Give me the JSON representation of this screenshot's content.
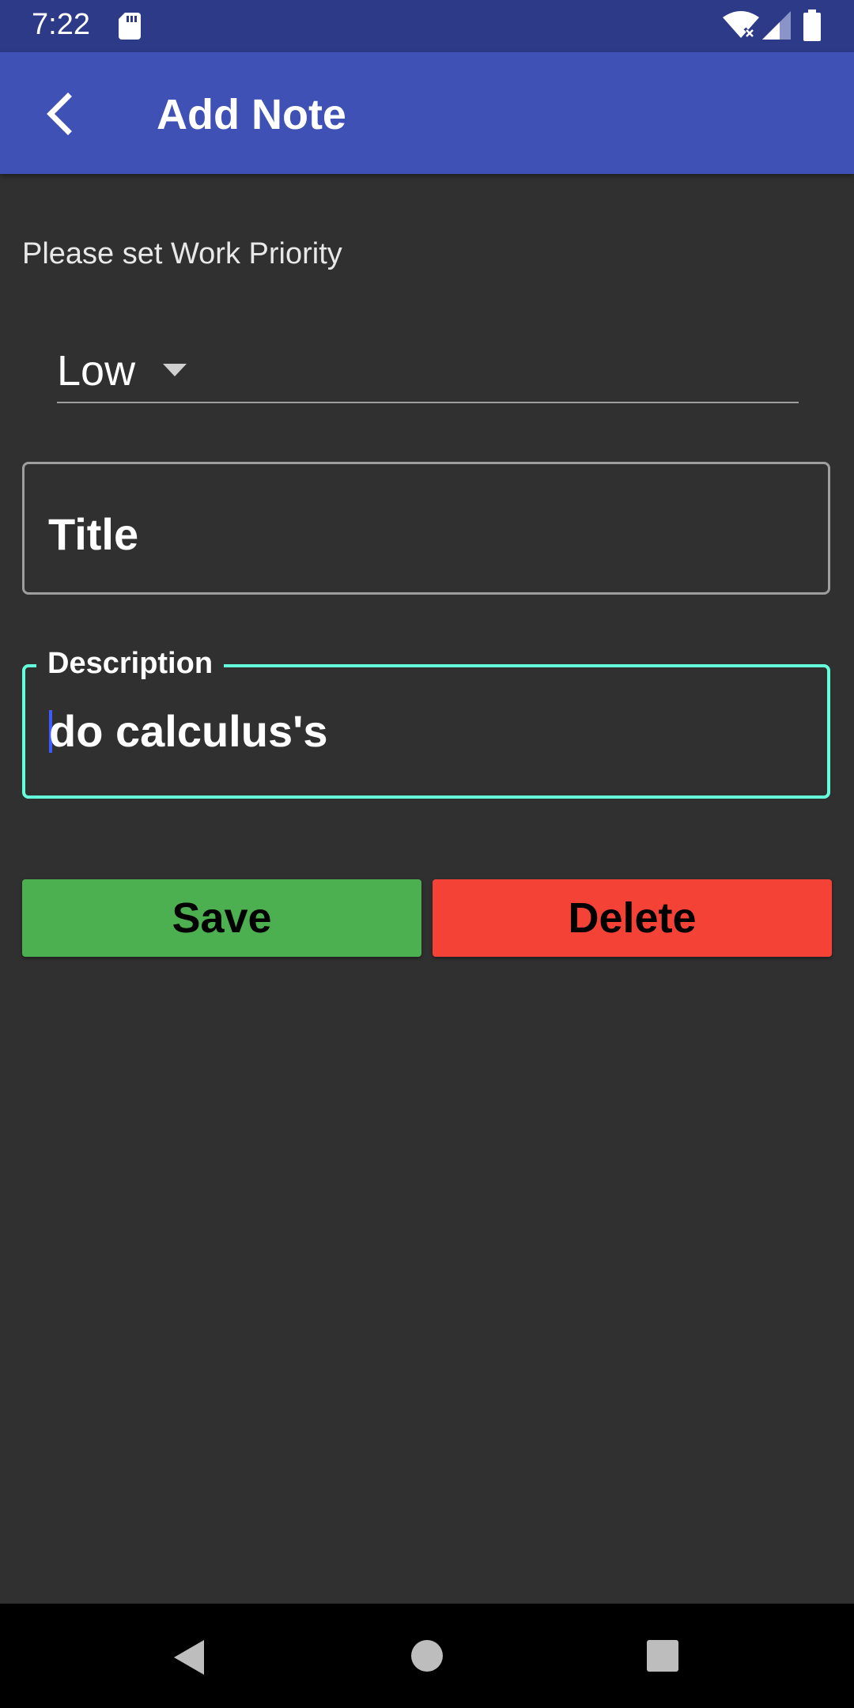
{
  "status_bar": {
    "time": "7:22",
    "icons": [
      "sd-card-icon",
      "wifi-icon",
      "signal-icon",
      "battery-icon"
    ]
  },
  "app_bar": {
    "title": "Add Note",
    "back_icon": "chevron-left-icon"
  },
  "priority": {
    "label": "Please set Work Priority",
    "selected": "Low"
  },
  "title_field": {
    "placeholder": "Title",
    "value": ""
  },
  "description_field": {
    "label": "Description",
    "value": "do calculus's"
  },
  "buttons": {
    "save_label": "Save",
    "delete_label": "Delete"
  },
  "nav_bar": {
    "icons": [
      "nav-back-icon",
      "nav-home-icon",
      "nav-recents-icon"
    ]
  },
  "colors": {
    "app_bar": "#3f51b5",
    "status_bar": "#2c3a88",
    "background": "#303030",
    "focus_accent": "#64ffda",
    "save": "#4caf50",
    "delete": "#f44336"
  }
}
